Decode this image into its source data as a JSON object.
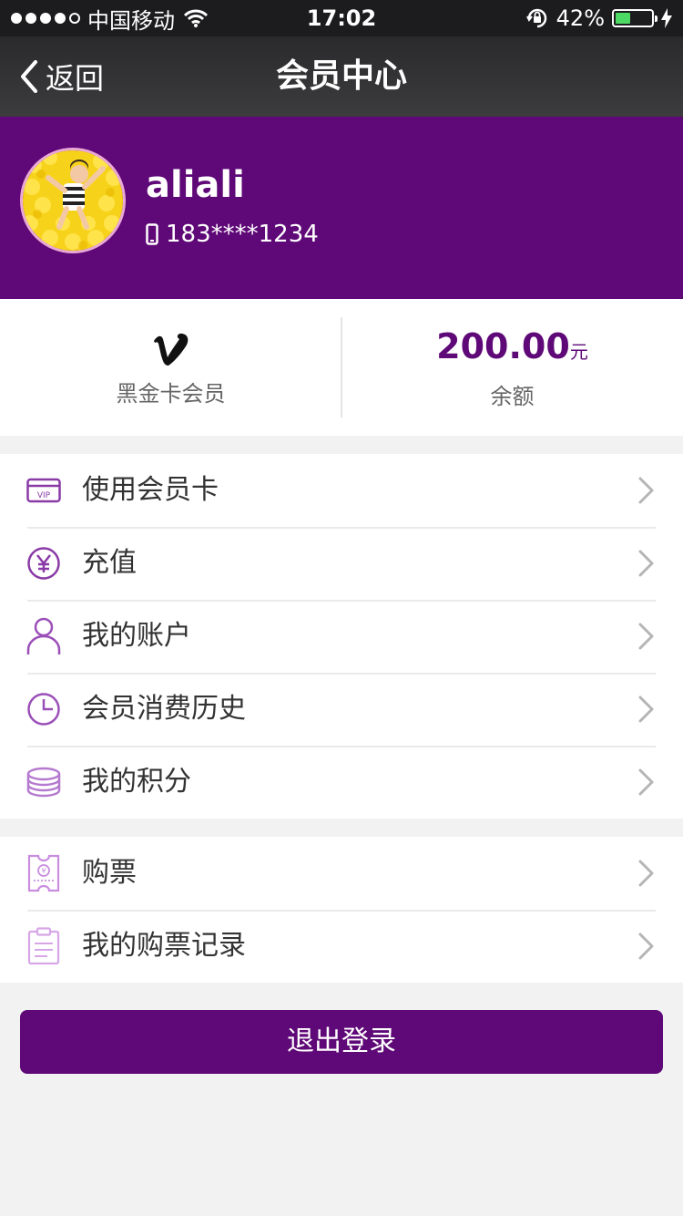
{
  "status_bar": {
    "carrier": "中国移动",
    "time": "17:02",
    "battery_percent": "42%",
    "battery_level": 0.42
  },
  "nav": {
    "back_label": "返回",
    "title": "会员中心"
  },
  "profile": {
    "username": "aliali",
    "phone": "183****1234"
  },
  "stats": {
    "member_level": "黑金卡会员",
    "balance_amount": "200.00",
    "balance_unit": "元",
    "balance_label": "余额"
  },
  "menu_group_1": [
    {
      "label": "使用会员卡",
      "icon": "vip-card-icon"
    },
    {
      "label": "充值",
      "icon": "yuan-icon"
    },
    {
      "label": "我的账户",
      "icon": "user-icon"
    },
    {
      "label": "会员消费历史",
      "icon": "clock-icon"
    },
    {
      "label": "我的积分",
      "icon": "coins-icon"
    }
  ],
  "menu_group_2": [
    {
      "label": "购票",
      "icon": "ticket-icon"
    },
    {
      "label": "我的购票记录",
      "icon": "clipboard-icon"
    }
  ],
  "logout_label": "退出登录",
  "colors": {
    "brand": "#5f0877",
    "icon": "#9b4fb8",
    "background": "#f2f2f2"
  }
}
